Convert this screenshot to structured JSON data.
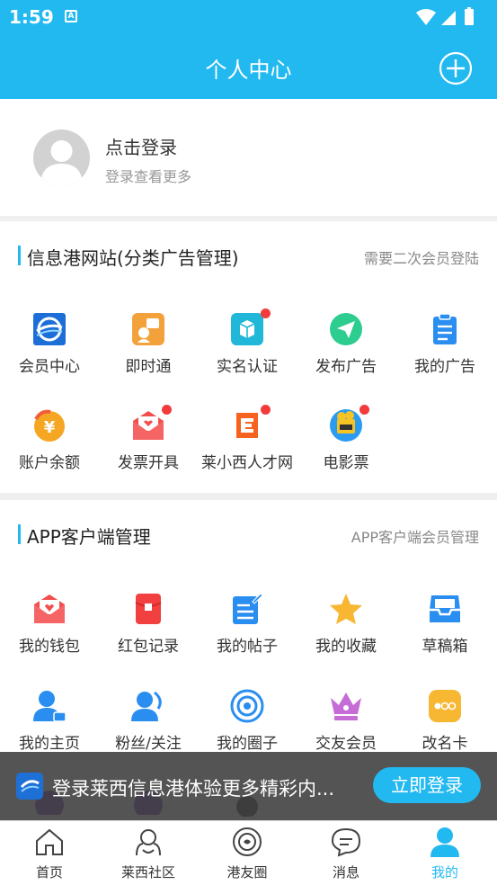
{
  "status_bar": {
    "time": "1:59",
    "app_badge": "A"
  },
  "header": {
    "title": "个人中心"
  },
  "profile": {
    "name": "点击登录",
    "subtitle": "登录查看更多"
  },
  "section1": {
    "title": "信息港网站(分类广告管理)",
    "hint": "需要二次会员登陆",
    "items": [
      {
        "label": "会员中心",
        "icon": "globe-icon"
      },
      {
        "label": "即时通",
        "icon": "chat-icon"
      },
      {
        "label": "实名认证",
        "icon": "box-icon",
        "badge": true
      },
      {
        "label": "发布广告",
        "icon": "send-icon"
      },
      {
        "label": "我的广告",
        "icon": "clipboard-icon"
      },
      {
        "label": "账户余额",
        "icon": "yen-icon"
      },
      {
        "label": "发票开具",
        "icon": "invoice-icon",
        "badge": true
      },
      {
        "label": "莱小西人才网",
        "icon": "talent-icon",
        "badge": true
      },
      {
        "label": "电影票",
        "icon": "movie-icon",
        "badge": true
      }
    ]
  },
  "section2": {
    "title": "APP客户端管理",
    "hint": "APP客户端会员管理",
    "items": [
      {
        "label": "我的钱包",
        "icon": "wallet-icon"
      },
      {
        "label": "红包记录",
        "icon": "red-packet-icon"
      },
      {
        "label": "我的帖子",
        "icon": "post-icon"
      },
      {
        "label": "我的收藏",
        "icon": "star-icon"
      },
      {
        "label": "草稿箱",
        "icon": "drafts-icon"
      },
      {
        "label": "我的主页",
        "icon": "user-home-icon"
      },
      {
        "label": "粉丝/关注",
        "icon": "fans-icon"
      },
      {
        "label": "我的圈子",
        "icon": "circle-icon"
      },
      {
        "label": "交友会员",
        "icon": "crown-icon"
      },
      {
        "label": "改名卡",
        "icon": "rename-card-icon"
      }
    ]
  },
  "toast": {
    "message": "登录莱西信息港体验更多精彩内...",
    "button": "立即登录"
  },
  "tabs": [
    {
      "label": "首页",
      "icon": "home-icon"
    },
    {
      "label": "莱西社区",
      "icon": "community-icon"
    },
    {
      "label": "港友圈",
      "icon": "moments-icon"
    },
    {
      "label": "消息",
      "icon": "message-icon"
    },
    {
      "label": "我的",
      "icon": "person-icon",
      "active": true
    }
  ],
  "colors": {
    "primary": "#22b9f0",
    "badge": "#f33b3b"
  }
}
